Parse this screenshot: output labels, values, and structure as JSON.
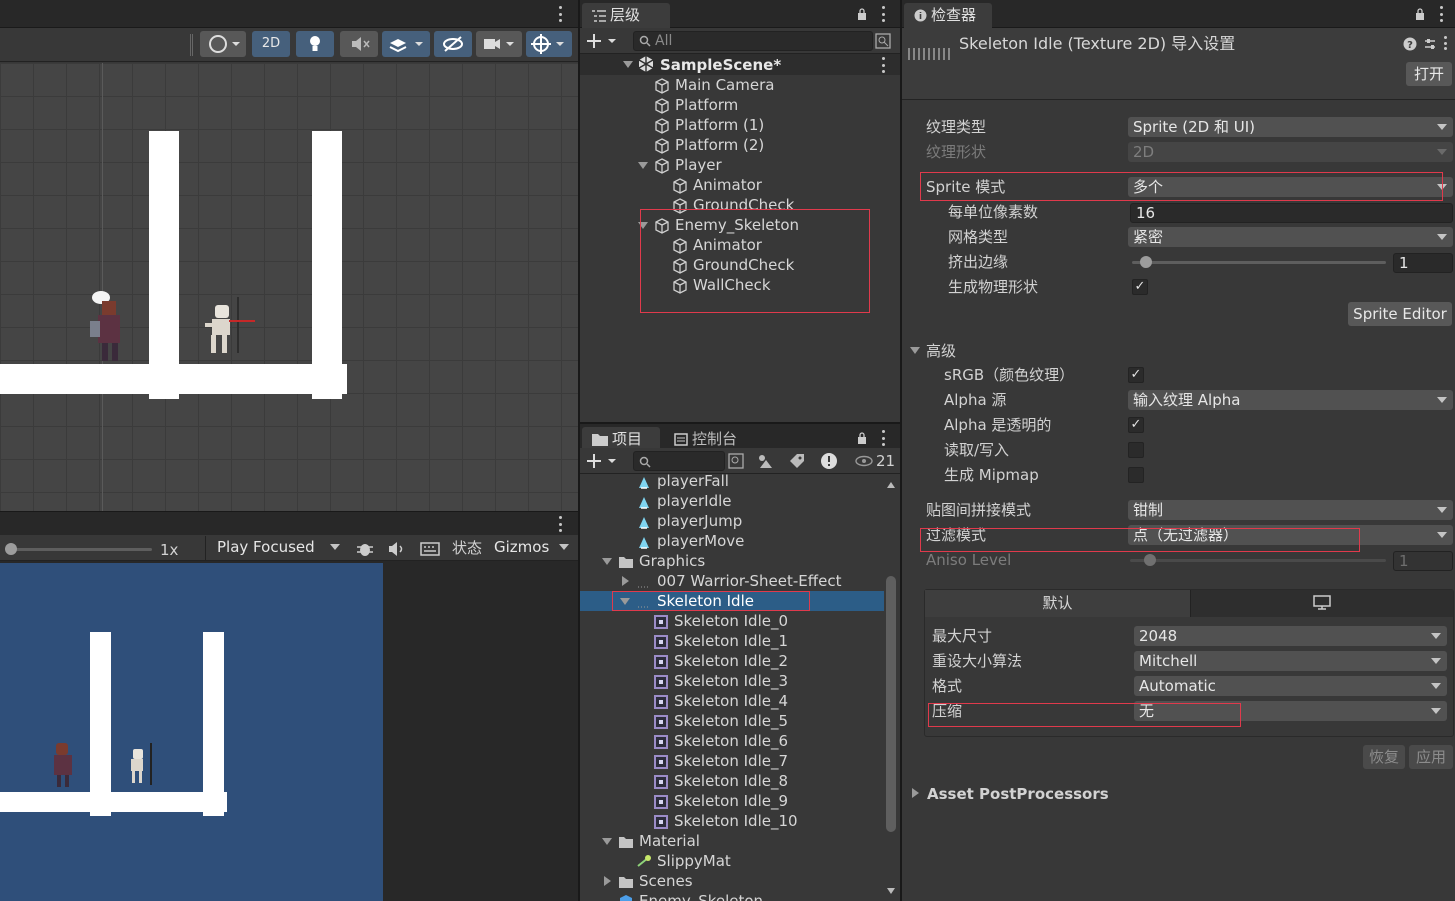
{
  "scene_toolbar": {
    "mode_2d": "2D"
  },
  "game_bar": {
    "scale": "1x",
    "play_mode": "Play Focused",
    "stats": "状态",
    "gizmos": "Gizmos"
  },
  "hierarchy": {
    "tab": "层级",
    "search_placeholder": "All",
    "scene": "SampleScene*",
    "items": [
      {
        "label": "Main Camera",
        "depth": 1
      },
      {
        "label": "Platform",
        "depth": 1
      },
      {
        "label": "Platform (1)",
        "depth": 1
      },
      {
        "label": "Platform (2)",
        "depth": 1
      },
      {
        "label": "Player",
        "depth": 1,
        "expanded": true
      },
      {
        "label": "Animator",
        "depth": 2
      },
      {
        "label": "GroundCheck",
        "depth": 2
      },
      {
        "label": "Enemy_Skeleton",
        "depth": 1,
        "expanded": true
      },
      {
        "label": "Animator",
        "depth": 2
      },
      {
        "label": "GroundCheck",
        "depth": 2
      },
      {
        "label": "WallCheck",
        "depth": 2
      }
    ]
  },
  "project": {
    "tab_project": "项目",
    "tab_console": "控制台",
    "hidden_count": "21",
    "items": [
      {
        "label": "playerFall",
        "kind": "anim",
        "depth": 2
      },
      {
        "label": "playerIdle",
        "kind": "anim",
        "depth": 2
      },
      {
        "label": "playerJump",
        "kind": "anim",
        "depth": 2
      },
      {
        "label": "playerMove",
        "kind": "anim",
        "depth": 2
      },
      {
        "label": "Graphics",
        "kind": "folder",
        "depth": 1,
        "expanded": true
      },
      {
        "label": "007 Warrior-Sheet-Effect",
        "kind": "texture",
        "depth": 2,
        "collapsed": true
      },
      {
        "label": "Skeleton Idle",
        "kind": "texture",
        "depth": 2,
        "expanded": true,
        "selected": true
      },
      {
        "label": "Skeleton Idle_0",
        "kind": "sprite",
        "depth": 3
      },
      {
        "label": "Skeleton Idle_1",
        "kind": "sprite",
        "depth": 3
      },
      {
        "label": "Skeleton Idle_2",
        "kind": "sprite",
        "depth": 3
      },
      {
        "label": "Skeleton Idle_3",
        "kind": "sprite",
        "depth": 3
      },
      {
        "label": "Skeleton Idle_4",
        "kind": "sprite",
        "depth": 3
      },
      {
        "label": "Skeleton Idle_5",
        "kind": "sprite",
        "depth": 3
      },
      {
        "label": "Skeleton Idle_6",
        "kind": "sprite",
        "depth": 3
      },
      {
        "label": "Skeleton Idle_7",
        "kind": "sprite",
        "depth": 3
      },
      {
        "label": "Skeleton Idle_8",
        "kind": "sprite",
        "depth": 3
      },
      {
        "label": "Skeleton Idle_9",
        "kind": "sprite",
        "depth": 3
      },
      {
        "label": "Skeleton Idle_10",
        "kind": "sprite",
        "depth": 3
      },
      {
        "label": "Material",
        "kind": "folder",
        "depth": 1,
        "expanded": true
      },
      {
        "label": "SlippyMat",
        "kind": "material",
        "depth": 2
      },
      {
        "label": "Scenes",
        "kind": "folder",
        "depth": 1,
        "collapsed": true
      },
      {
        "label": "Enemy_Skeleton",
        "kind": "prefab",
        "depth": 1
      }
    ]
  },
  "inspector": {
    "tab": "检查器",
    "title": "Skeleton Idle (Texture 2D) 导入设置",
    "open_btn": "打开",
    "texture_type_label": "纹理类型",
    "texture_type": "Sprite (2D 和 UI)",
    "texture_shape_label": "纹理形状",
    "texture_shape": "2D",
    "sprite_mode_label": "Sprite 模式",
    "sprite_mode": "多个",
    "ppu_label": "每单位像素数",
    "ppu": "16",
    "mesh_type_label": "网格类型",
    "mesh_type": "紧密",
    "extrude_label": "挤出边缘",
    "extrude": "1",
    "extrude_fraction": 0.0,
    "physics_label": "生成物理形状",
    "physics_checked": true,
    "sprite_editor_btn": "Sprite Editor",
    "advanced_label": "高级",
    "srgb_label": "sRGB（颜色纹理）",
    "srgb_checked": true,
    "alpha_src_label": "Alpha 源",
    "alpha_src": "输入纹理 Alpha",
    "alpha_trans_label": "Alpha 是透明的",
    "alpha_trans_checked": true,
    "rw_label": "读取/写入",
    "rw_checked": false,
    "mipmap_label": "生成 Mipmap",
    "mipmap_checked": false,
    "wrap_label": "贴图间拼接模式",
    "wrap": "钳制",
    "filter_label": "过滤模式",
    "filter": "点（无过滤器）",
    "aniso_label": "Aniso Level",
    "aniso": "1",
    "aniso_fraction": 0.0,
    "platform_default": "默认",
    "max_size_label": "最大尺寸",
    "max_size": "2048",
    "resize_label": "重设大小算法",
    "resize": "Mitchell",
    "format_label": "格式",
    "format": "Automatic",
    "compress_label": "压缩",
    "compress": "无",
    "revert_btn": "恢复",
    "apply_btn": "应用",
    "postprocessors": "Asset PostProcessors"
  }
}
